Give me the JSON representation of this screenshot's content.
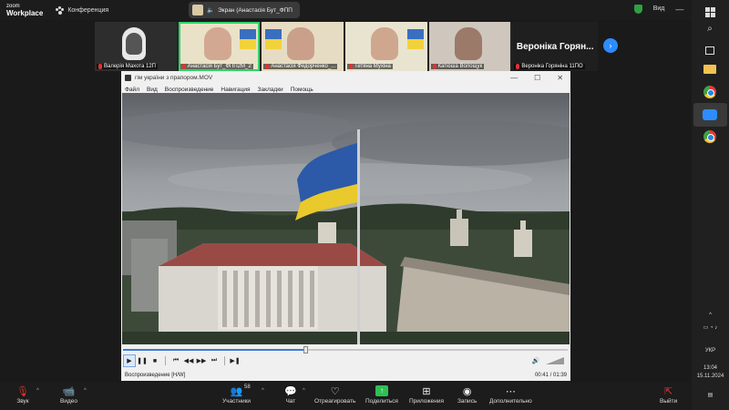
{
  "zoom": {
    "logo_line1": "zoom",
    "logo_line2": "Workplace",
    "meeting_label": "Конференция",
    "share_pill": "Экран (Анастасія Бут_ФПП",
    "view_label": "Вид"
  },
  "participants": [
    {
      "name": "Валерія Махота 12П",
      "muted": true
    },
    {
      "name": "Анастасія Бут_ФПП2М_2",
      "muted": true,
      "active": true
    },
    {
      "name": "Анастасія Федорченко_...",
      "muted": true
    },
    {
      "name": "Тетяна Мухіна",
      "muted": true
    },
    {
      "name": "Катюша Волощук",
      "muted": true
    },
    {
      "name": "Вероніка Горяніна 11ПО",
      "big_label": "Вероніка Горян...",
      "muted": true
    }
  ],
  "player": {
    "title": "гім україни з прапором.MOV",
    "menu": [
      "Файл",
      "Вид",
      "Воспроизведение",
      "Навигация",
      "Закладки",
      "Помощь"
    ],
    "status": "Воспроизведение [H/W]",
    "time": "00:41 / 01:39",
    "progress": 0.41
  },
  "toolbar": {
    "audio": "Звук",
    "video": "Видео",
    "participants": "Участники",
    "participants_count": "58",
    "chat": "Чат",
    "react": "Отреагировать",
    "share": "Поделиться",
    "apps": "Приложения",
    "record": "Запись",
    "more": "Дополнительно",
    "leave": "Выйти"
  },
  "taskbar": {
    "lang": "УКР",
    "time": "13:04",
    "date": "15.11.2024"
  }
}
